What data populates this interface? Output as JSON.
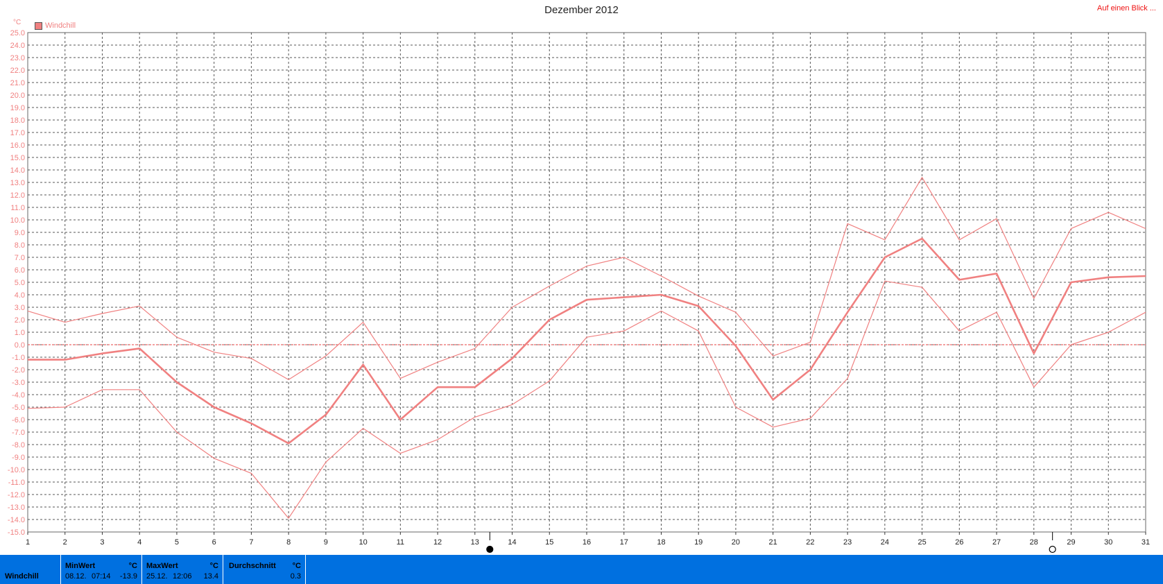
{
  "title": "Dezember 2012",
  "top_link": "Auf einen Blick ...",
  "legend": {
    "label": "Windchill",
    "color": "#f08080"
  },
  "y_unit": "°C",
  "chart_data": {
    "type": "line",
    "title": "Dezember 2012",
    "x": [
      1,
      2,
      3,
      4,
      5,
      6,
      7,
      8,
      9,
      10,
      11,
      12,
      13,
      14,
      15,
      16,
      17,
      18,
      19,
      20,
      21,
      22,
      23,
      24,
      25,
      26,
      27,
      28,
      29,
      30,
      31
    ],
    "ylim": [
      -15,
      25
    ],
    "y_ticks": [
      25.0,
      24.0,
      23.0,
      22.0,
      21.0,
      20.0,
      19.0,
      18.0,
      17.0,
      16.0,
      15.0,
      14.0,
      13.0,
      12.0,
      11.0,
      10.0,
      9.0,
      8.0,
      7.0,
      6.0,
      5.0,
      4.0,
      3.0,
      2.0,
      1.0,
      0.0,
      -1.0,
      -2.0,
      -3.0,
      -4.0,
      -5.0,
      -6.0,
      -7.0,
      -8.0,
      -9.0,
      -10.0,
      -11.0,
      -12.0,
      -13.0,
      -14.0,
      -15.0
    ],
    "y_tick_labels": [
      "25.0",
      "24.0",
      "23.0",
      "22.0",
      "21.0",
      "20.0",
      "19.0",
      "18.0",
      "17.0",
      "16.0",
      "15.0",
      "14.0",
      "13.0",
      "12.0",
      "11.0",
      "10.0",
      "9.0",
      "8.0",
      "7.0",
      "6.0",
      "5.0",
      "4.0",
      "3.0",
      "2.0",
      "1.0",
      "0.0",
      "-1.0",
      "-2.0",
      "-3.0",
      "-4.0",
      "-5.0",
      "-6.0",
      "-7.0",
      "-8.0",
      "-9.0",
      "-10.0",
      "-11.0",
      "-12.0",
      "-13.0",
      "-14.0",
      "-15.0"
    ],
    "grid": true,
    "zero_line": true,
    "series": [
      {
        "name": "Windchill",
        "role": "max",
        "values": [
          2.7,
          1.8,
          2.5,
          3.1,
          0.6,
          -0.6,
          -1.1,
          -2.8,
          -0.9,
          1.8,
          -2.7,
          -1.4,
          -0.3,
          3.0,
          4.7,
          6.3,
          7.0,
          5.5,
          3.9,
          2.6,
          -0.9,
          0.2,
          9.7,
          8.4,
          13.4,
          8.4,
          10.1,
          3.7,
          9.3,
          10.6,
          9.3
        ]
      },
      {
        "name": "Windchill",
        "role": "avg",
        "values": [
          -1.2,
          -1.2,
          -0.7,
          -0.3,
          -3.0,
          -5.0,
          -6.3,
          -7.9,
          -5.6,
          -1.6,
          -6.0,
          -3.4,
          -3.4,
          -1.1,
          2.0,
          3.6,
          3.8,
          4.0,
          3.1,
          -0.1,
          -4.4,
          -2.0,
          2.6,
          7.0,
          8.5,
          5.2,
          5.7,
          -0.7,
          5.0,
          5.4,
          5.5
        ]
      },
      {
        "name": "Windchill",
        "role": "min",
        "values": [
          -5.1,
          -5.0,
          -3.6,
          -3.6,
          -7.0,
          -9.1,
          -10.3,
          -13.9,
          -9.4,
          -6.7,
          -8.7,
          -7.6,
          -5.8,
          -4.8,
          -2.9,
          0.6,
          1.1,
          2.7,
          1.1,
          -5.0,
          -6.6,
          -5.9,
          -2.7,
          5.1,
          4.6,
          1.1,
          2.6,
          -3.4,
          0.0,
          1.0,
          2.6
        ]
      }
    ],
    "moon_phases": [
      {
        "day": 13.4,
        "phase": "new-moon"
      },
      {
        "day": 28.5,
        "phase": "full-moon"
      }
    ]
  },
  "footer": {
    "row_label": "Windchill",
    "min": {
      "header": "MinWert",
      "unit": "°C",
      "date": "08.12.",
      "time": "07:14",
      "value": "-13.9"
    },
    "max": {
      "header": "MaxWert",
      "unit": "°C",
      "date": "25.12.",
      "time": "12:06",
      "value": "13.4"
    },
    "avg": {
      "header": "Durchschnitt",
      "unit": "°C",
      "value": "0.3"
    }
  }
}
